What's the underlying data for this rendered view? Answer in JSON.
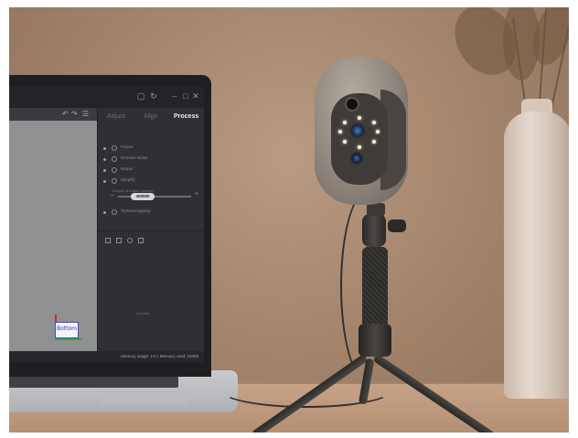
{
  "laptop_app": {
    "tabs": [
      "Adjust",
      "Align",
      "Process"
    ],
    "active_tab": "Process",
    "options": [
      "Fusion",
      "Remove Noise",
      "Repair",
      "Simplify",
      "Texturemapping"
    ],
    "slider": {
      "caption": "Simplify and face number",
      "value": "400000"
    },
    "viewport_cube_label": "Bottom",
    "panel_placeholder": "No data",
    "status": "Memory usage: 1% | Memory used: 23488"
  },
  "colors": {
    "wall": "#a5866d",
    "desk": "#c7a287",
    "app_background": "#2b2c2f",
    "scanner_shell": "#8e857c",
    "vase": "#e6dad0"
  }
}
